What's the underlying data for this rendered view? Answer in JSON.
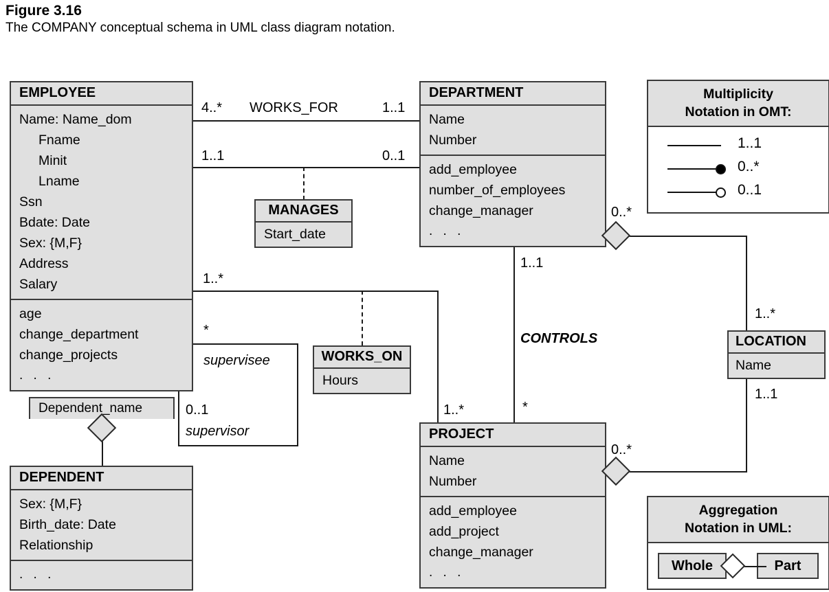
{
  "figure": {
    "number": "Figure 3.16",
    "caption": "The COMPANY conceptual schema in UML class diagram notation."
  },
  "classes": {
    "employee": {
      "name": "EMPLOYEE",
      "attributes": [
        "Name: Name_dom",
        "Fname",
        "Minit",
        "Lname",
        "Ssn",
        "Bdate: Date",
        "Sex: {M,F}",
        "Address",
        "Salary"
      ],
      "operations": [
        "age",
        "change_department",
        "change_projects",
        ". . ."
      ]
    },
    "department": {
      "name": "DEPARTMENT",
      "attributes": [
        "Name",
        "Number"
      ],
      "operations": [
        "add_employee",
        "number_of_employees",
        "change_manager",
        ". . ."
      ]
    },
    "project": {
      "name": "PROJECT",
      "attributes": [
        "Name",
        "Number"
      ],
      "operations": [
        "add_employee",
        "add_project",
        "change_manager",
        ". . ."
      ]
    },
    "dependent": {
      "name": "DEPENDENT",
      "attributes": [
        "Sex: {M,F}",
        "Birth_date: Date",
        "Relationship"
      ],
      "operations": [
        ". . ."
      ]
    },
    "location": {
      "name": "LOCATION",
      "attributes": [
        "Name"
      ]
    },
    "manages": {
      "name": "MANAGES",
      "attributes": [
        "Start_date"
      ]
    },
    "works_on": {
      "name": "WORKS_ON",
      "attributes": [
        "Hours"
      ]
    },
    "dependent_name": {
      "label": "Dependent_name"
    }
  },
  "associations": {
    "works_for": {
      "name": "WORKS_FOR",
      "employee_end": "4..*",
      "department_end": "1..1"
    },
    "manages": {
      "employee_end": "1..1",
      "department_end": "0..1"
    },
    "works_on": {
      "employee_end": "1..*",
      "project_end": "1..*"
    },
    "controls": {
      "name": "CONTROLS",
      "department_end": "1..1",
      "project_end": "*"
    },
    "supervision": {
      "supervisee_mult": "*",
      "supervisee_role": "supervisee",
      "supervisor_mult": "0..1",
      "supervisor_role": "supervisor"
    },
    "dept_locations": {
      "department_end": "0..*",
      "location_end": "1..*"
    },
    "proj_location": {
      "project_end": "0..*",
      "location_end": "1..1"
    }
  },
  "legends": {
    "multiplicity": {
      "title_line1": "Multiplicity",
      "title_line2": "Notation in OMT:",
      "rows": [
        {
          "label": "1..1",
          "marker": "none"
        },
        {
          "label": "0..*",
          "marker": "filled"
        },
        {
          "label": "0..1",
          "marker": "hollow"
        }
      ]
    },
    "aggregation": {
      "title_line1": "Aggregation",
      "title_line2": "Notation in UML:",
      "whole_label": "Whole",
      "part_label": "Part"
    }
  },
  "colors": {
    "box_fill": "#e0e0e0",
    "box_border": "#3a3a3a",
    "line": "#1a1a1a",
    "page_bg": "#ffffff"
  }
}
